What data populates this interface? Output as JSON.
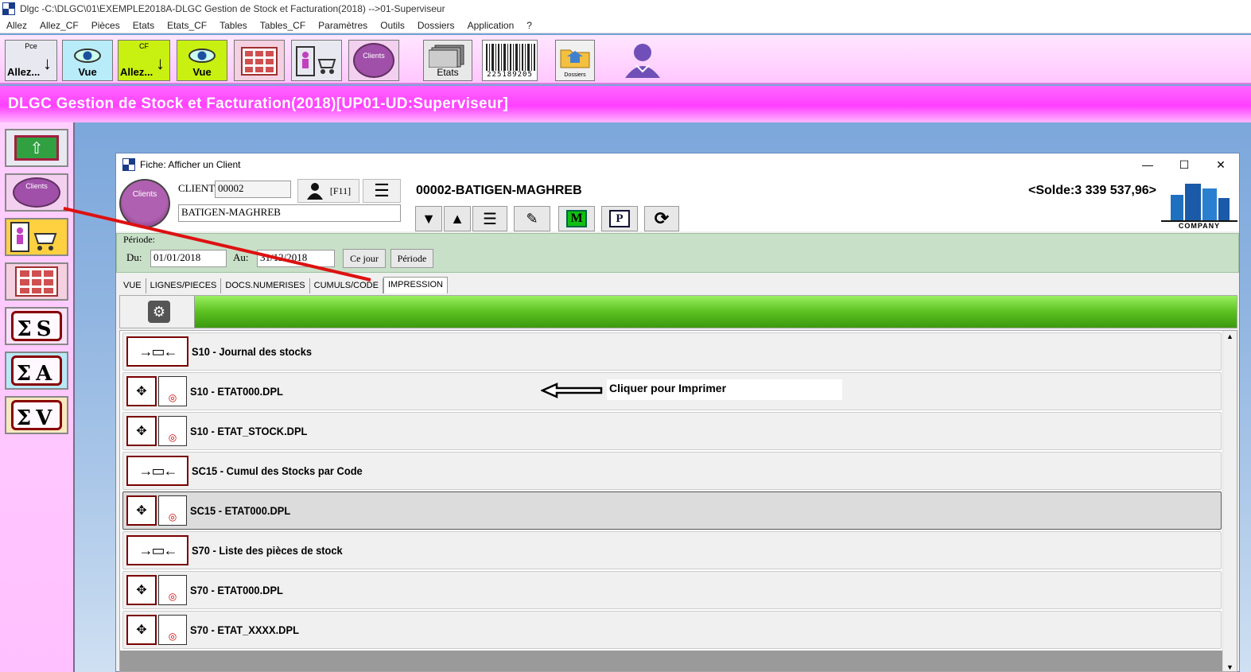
{
  "window": {
    "title": "Dlgc -C:\\DLGC\\01\\EXEMPLE2018A-DLGC Gestion de Stock et Facturation(2018) -->01-Superviseur"
  },
  "menu": [
    "Allez",
    "Allez_CF",
    "Pièces",
    "Etats",
    "Etats_CF",
    "Tables",
    "Tables_CF",
    "Paramètres",
    "Outils",
    "Dossiers",
    "Application",
    "?"
  ],
  "toolbar": {
    "pce_small": "Pce",
    "pce_label": "Allez...",
    "vue1_label": "Vue",
    "cf_small": "CF",
    "cf_label": "Allez...",
    "vue2_label": "Vue",
    "clients_small": "Clients",
    "etats_label": "Etats",
    "barcode_number": "225189205",
    "dossiers_small": "Dossiers"
  },
  "banner": {
    "title": "DLGC Gestion de Stock et Facturation(2018)[UP01-UD:Superviseur]"
  },
  "sidebar": {
    "clients_small": "Clients",
    "sigma_s": "S",
    "sigma_a": "A",
    "sigma_v": "V"
  },
  "dialog": {
    "title": "Fiche: Afficher un Client",
    "controls": {
      "minimize": "—",
      "maximize": "☐",
      "close": "✕"
    },
    "client_icon_label": "Clients",
    "client_label": "CLIENT:",
    "client_code": "00002",
    "f11_label": "[F11]",
    "client_name": "BATIGEN-MAGHREB",
    "header_title": "00002-BATIGEN-MAGHREB",
    "solde": "<Solde:3 339 537,96>",
    "company_label": "COMPANY",
    "period_label": "Période:",
    "du_label": "Du:",
    "du_value": "01/01/2018",
    "au_label": "Au:",
    "au_value": "31/12/2018",
    "ce_jour_label": "Ce jour",
    "periode_btn_label": "Période",
    "tabs": [
      "VUE",
      "LIGNES/PIECES",
      "DOCS.NUMERISES",
      "CUMULS/CODE",
      "IMPRESSION"
    ],
    "annotation": "Cliquer pour Imprimer",
    "reports": [
      {
        "label": "S10 - Journal des stocks",
        "kind": "wide"
      },
      {
        "label": "S10 - ETAT000.DPL",
        "kind": "doc"
      },
      {
        "label": "S10 - ETAT_STOCK.DPL",
        "kind": "doc"
      },
      {
        "label": "SC15 - Cumul des Stocks par Code",
        "kind": "wide"
      },
      {
        "label": "SC15 - ETAT000.DPL",
        "kind": "doc",
        "selected": true
      },
      {
        "label": "S70 - Liste des pièces de stock",
        "kind": "wide"
      },
      {
        "label": "S70 - ETAT000.DPL",
        "kind": "doc"
      },
      {
        "label": "S70 - ETAT_XXXX.DPL",
        "kind": "doc"
      }
    ]
  },
  "colors": {
    "banner": "#ff40ff",
    "toolbar": "#ffc7ff",
    "accent_green": "#5cc020",
    "arrow_red": "#dd1111"
  },
  "icons": [
    "eye-icon",
    "barcode-icon",
    "folder-icon",
    "user-icon",
    "gear-icon",
    "refresh-icon",
    "menu-icon"
  ]
}
